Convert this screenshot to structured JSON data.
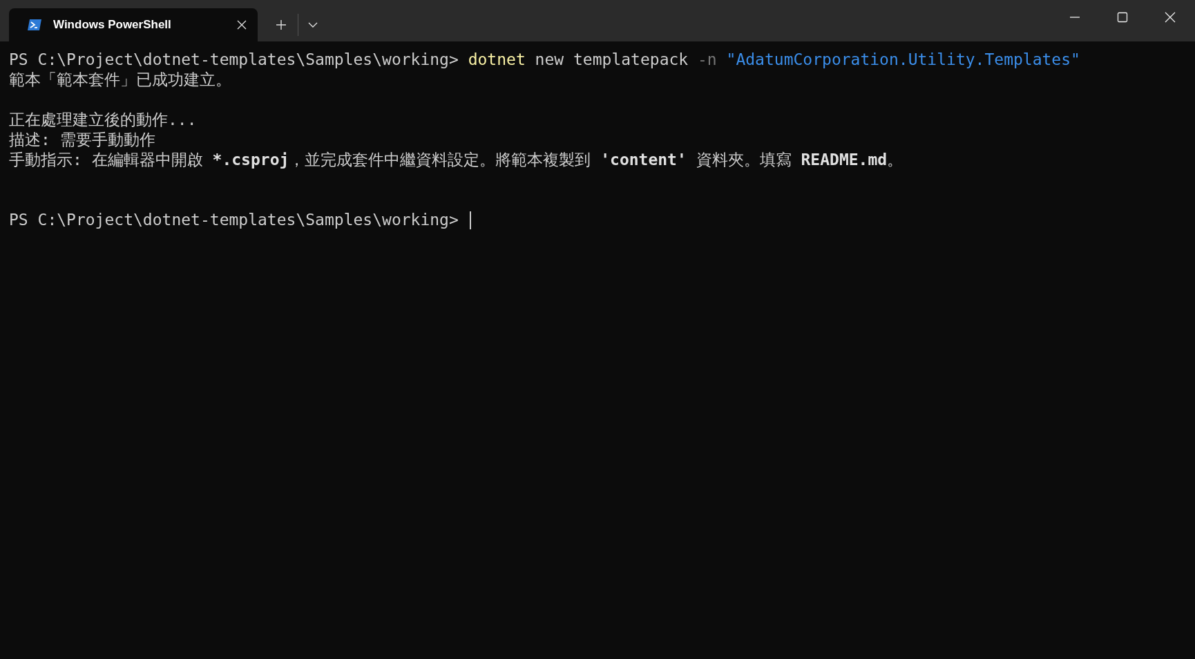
{
  "tabs": [
    {
      "title": "Windows PowerShell",
      "selected": true
    }
  ],
  "command": {
    "prompt": "PS C:\\Project\\dotnet-templates\\Samples\\working> ",
    "segments": [
      {
        "kind": "command",
        "text": "dotnet"
      },
      {
        "kind": "plain",
        "text": " new templatepack "
      },
      {
        "kind": "parameter",
        "text": "-n"
      },
      {
        "kind": "string",
        "text": " \"AdatumCorporation.Utility.Templates\""
      }
    ]
  },
  "result": {
    "lines": [
      "範本「範本套件」已成功建立。"
    ]
  },
  "post_actions": {
    "lines": [
      [
        {
          "kind": "plain",
          "text": "正在處理建立後的動作..."
        }
      ],
      [
        {
          "kind": "plain",
          "text": "描述: 需要手動動作"
        }
      ],
      [
        {
          "kind": "plain",
          "text": "手動指示: 在編輯器中開啟 "
        },
        {
          "kind": "bold",
          "text": "*.csproj"
        },
        {
          "kind": "plain",
          "text": "，並完成套件中繼資料設定。將範本複製到 "
        },
        {
          "kind": "bold",
          "text": "'content'"
        },
        {
          "kind": "plain",
          "text": " 資料夾。填寫 "
        },
        {
          "kind": "bold",
          "text": "README.md"
        },
        {
          "kind": "plain",
          "text": "。"
        }
      ]
    ]
  },
  "prompt_line": {
    "prompt": "PS C:\\Project\\dotnet-templates\\Samples\\working> ",
    "cursor_visible": true
  }
}
